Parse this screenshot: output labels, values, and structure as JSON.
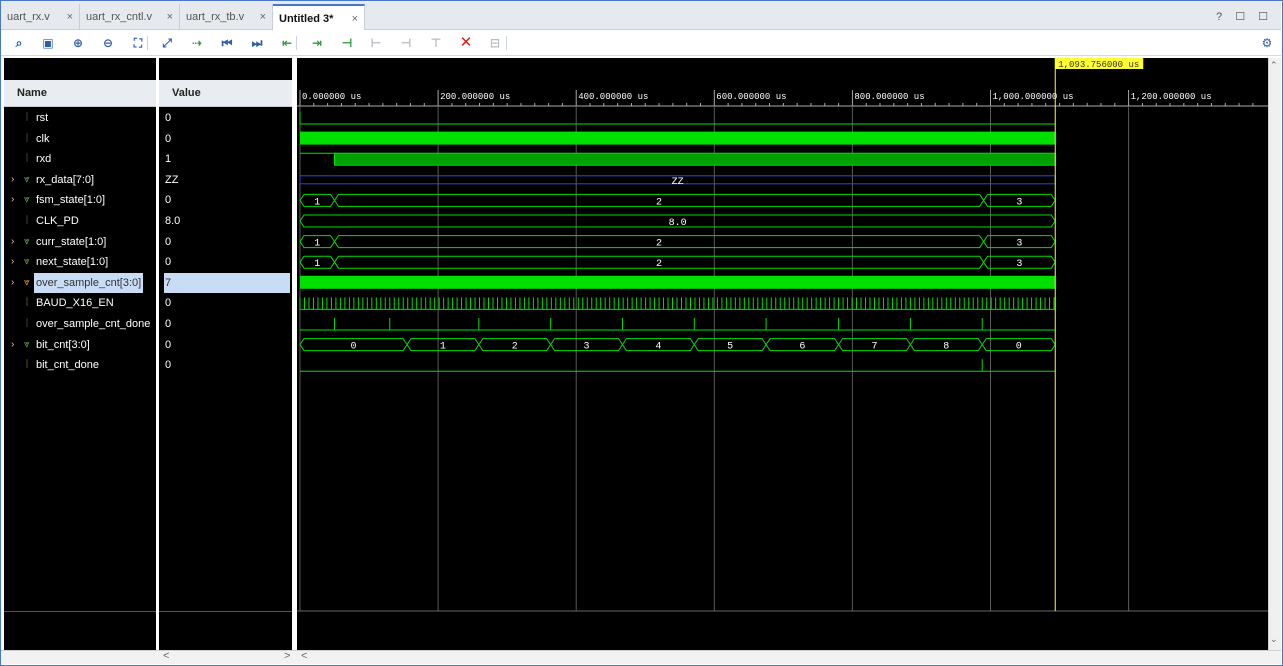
{
  "tabs": [
    {
      "label": "uart_rx.v",
      "active": false
    },
    {
      "label": "uart_rx_cntl.v",
      "active": false
    },
    {
      "label": "uart_rx_tb.v",
      "active": false
    },
    {
      "label": "Untitled 3*",
      "active": true
    }
  ],
  "window_controls": "? ☐ ☐",
  "toolbar": [
    {
      "name": "search-icon",
      "glyph": "⌕"
    },
    {
      "name": "save-icon",
      "glyph": "▣"
    },
    {
      "name": "zoom-in-icon",
      "glyph": "⊕"
    },
    {
      "name": "zoom-out-icon",
      "glyph": "⊖"
    },
    {
      "name": "zoom-fit-icon",
      "glyph": "⛶"
    },
    {
      "name": "cursor-icon",
      "glyph": "⤢"
    },
    {
      "name": "go-to-cursor-icon",
      "glyph": "⇢"
    },
    {
      "name": "go-to-time-zero-icon",
      "glyph": "⏮"
    },
    {
      "name": "go-to-last-time-icon",
      "glyph": "⏭"
    },
    {
      "name": "previous-transition-icon",
      "glyph": "⇤"
    },
    {
      "name": "next-transition-icon",
      "glyph": "⇥"
    },
    {
      "name": "add-marker-icon",
      "glyph": "⊣"
    },
    {
      "name": "previous-marker-icon",
      "glyph": "⊢"
    },
    {
      "name": "next-marker-icon",
      "glyph": "⊣"
    },
    {
      "name": "swap-cursors-icon",
      "glyph": "⊤"
    },
    {
      "name": "delete-markers-icon",
      "glyph": "✕"
    },
    {
      "name": "snap-to-transition-icon",
      "glyph": "⊟"
    }
  ],
  "settings_icon": "⚙",
  "headers": {
    "name": "Name",
    "value": "Value"
  },
  "cursor_label": "1,093.756000 us",
  "scrollbar": {
    "left": "<",
    "right": ">",
    "wave_left": "<"
  },
  "time_ticks": [
    "0.000000 us",
    "200.000000 us",
    "400.000000 us",
    "600.000000 us",
    "800.000000 us",
    "1,000.000000 us",
    "1,200.000000 us"
  ],
  "signals": [
    {
      "name": "rst",
      "value": "0",
      "expand": false,
      "icon": "bit",
      "selected": false
    },
    {
      "name": "clk",
      "value": "0",
      "expand": false,
      "icon": "bit",
      "selected": false
    },
    {
      "name": "rxd",
      "value": "1",
      "expand": false,
      "icon": "bit",
      "selected": false
    },
    {
      "name": "rx_data[7:0]",
      "value": "ZZ",
      "expand": true,
      "icon": "bus",
      "selected": false
    },
    {
      "name": "fsm_state[1:0]",
      "value": "0",
      "expand": true,
      "icon": "bus",
      "selected": false
    },
    {
      "name": "CLK_PD",
      "value": "8.0",
      "expand": false,
      "icon": "bit",
      "selected": false
    },
    {
      "name": "curr_state[1:0]",
      "value": "0",
      "expand": true,
      "icon": "bus",
      "selected": false
    },
    {
      "name": "next_state[1:0]",
      "value": "0",
      "expand": true,
      "icon": "bus",
      "selected": false
    },
    {
      "name": "over_sample_cnt[3:0]",
      "value": "7",
      "expand": true,
      "icon": "bus-orange",
      "selected": true
    },
    {
      "name": "BAUD_X16_EN",
      "value": "0",
      "expand": false,
      "icon": "bit-orange",
      "selected": false
    },
    {
      "name": "over_sample_cnt_done",
      "value": "0",
      "expand": false,
      "icon": "bit",
      "selected": false
    },
    {
      "name": "bit_cnt[3:0]",
      "value": "0",
      "expand": true,
      "icon": "bus",
      "selected": false
    },
    {
      "name": "bit_cnt_done",
      "value": "0",
      "expand": false,
      "icon": "bit-orange",
      "selected": false
    }
  ],
  "bus_values": {
    "rx_data": [
      "ZZ"
    ],
    "fsm_state": [
      "1",
      "2",
      "3"
    ],
    "CLK_PD": [
      "8.0"
    ],
    "curr_state": [
      "1",
      "2",
      "3"
    ],
    "next_state": [
      "1",
      "2",
      "3"
    ],
    "bit_cnt": [
      "0",
      "1",
      "2",
      "3",
      "4",
      "5",
      "6",
      "7",
      "8",
      "0"
    ]
  },
  "colors": {
    "wave": "#00e000",
    "wave_dim": "#00a000",
    "cursor": "#ffff33",
    "bus_z": "#2a4bd6",
    "grid": "#5a5a5a"
  }
}
